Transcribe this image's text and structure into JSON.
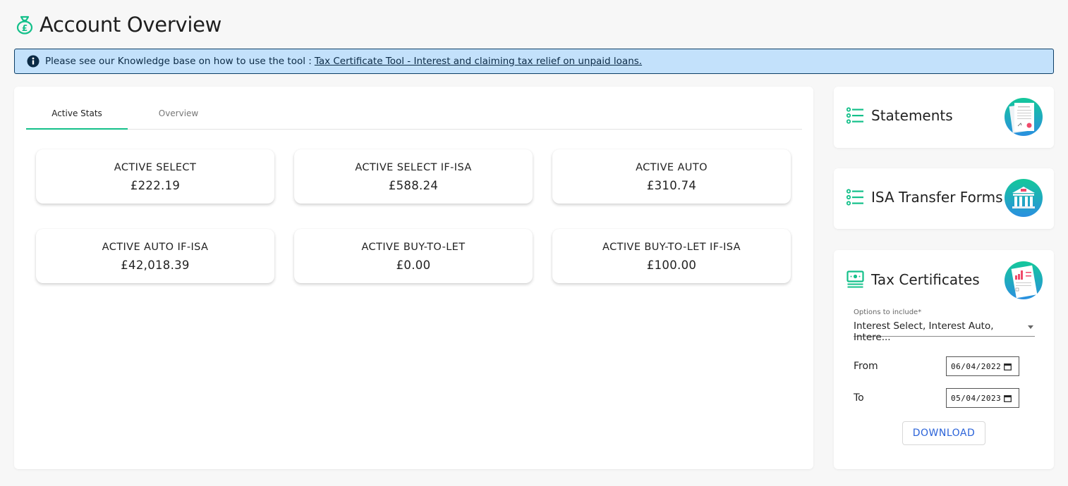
{
  "header": {
    "title": "Account Overview",
    "icon": "money-bag-pound-icon"
  },
  "banner": {
    "icon": "info-circle-icon",
    "text": "Please see our Knowledge base on how to use the tool :",
    "link_text": "Tax Certificate Tool - Interest and claiming tax relief on unpaid loans."
  },
  "tabs": [
    {
      "label": "Active Stats",
      "active": true
    },
    {
      "label": "Overview",
      "active": false
    }
  ],
  "stats": [
    {
      "label": "ACTIVE SELECT",
      "value": "£222.19"
    },
    {
      "label": "ACTIVE SELECT IF-ISA",
      "value": "£588.24"
    },
    {
      "label": "ACTIVE AUTO",
      "value": "£310.74"
    },
    {
      "label": "ACTIVE AUTO IF-ISA",
      "value": "£42,018.39"
    },
    {
      "label": "ACTIVE BUY-TO-LET",
      "value": "£0.00"
    },
    {
      "label": "ACTIVE BUY-TO-LET IF-ISA",
      "value": "£100.00"
    }
  ],
  "side_cards": {
    "statements": {
      "title": "Statements",
      "icon": "list-icon",
      "illustration": "documents-illustration"
    },
    "isa_transfer": {
      "title": "ISA Transfer Forms",
      "icon": "list-icon",
      "illustration": "bank-building-illustration"
    },
    "tax_certificates": {
      "title": "Tax Certificates",
      "icon": "banknote-icon",
      "illustration": "report-chart-illustration",
      "select_label": "Options to include*",
      "select_value": "Interest Select, Interest Auto, Intere...",
      "from_label": "From",
      "from_value": "06/04/2022",
      "to_label": "To",
      "to_value": "05/04/2023",
      "download_label": "DOWNLOAD"
    }
  },
  "colors": {
    "accent": "#14c08a",
    "banner_bg": "#c3e1fb",
    "banner_border": "#0c3e66",
    "link_button": "#2b63d9"
  }
}
